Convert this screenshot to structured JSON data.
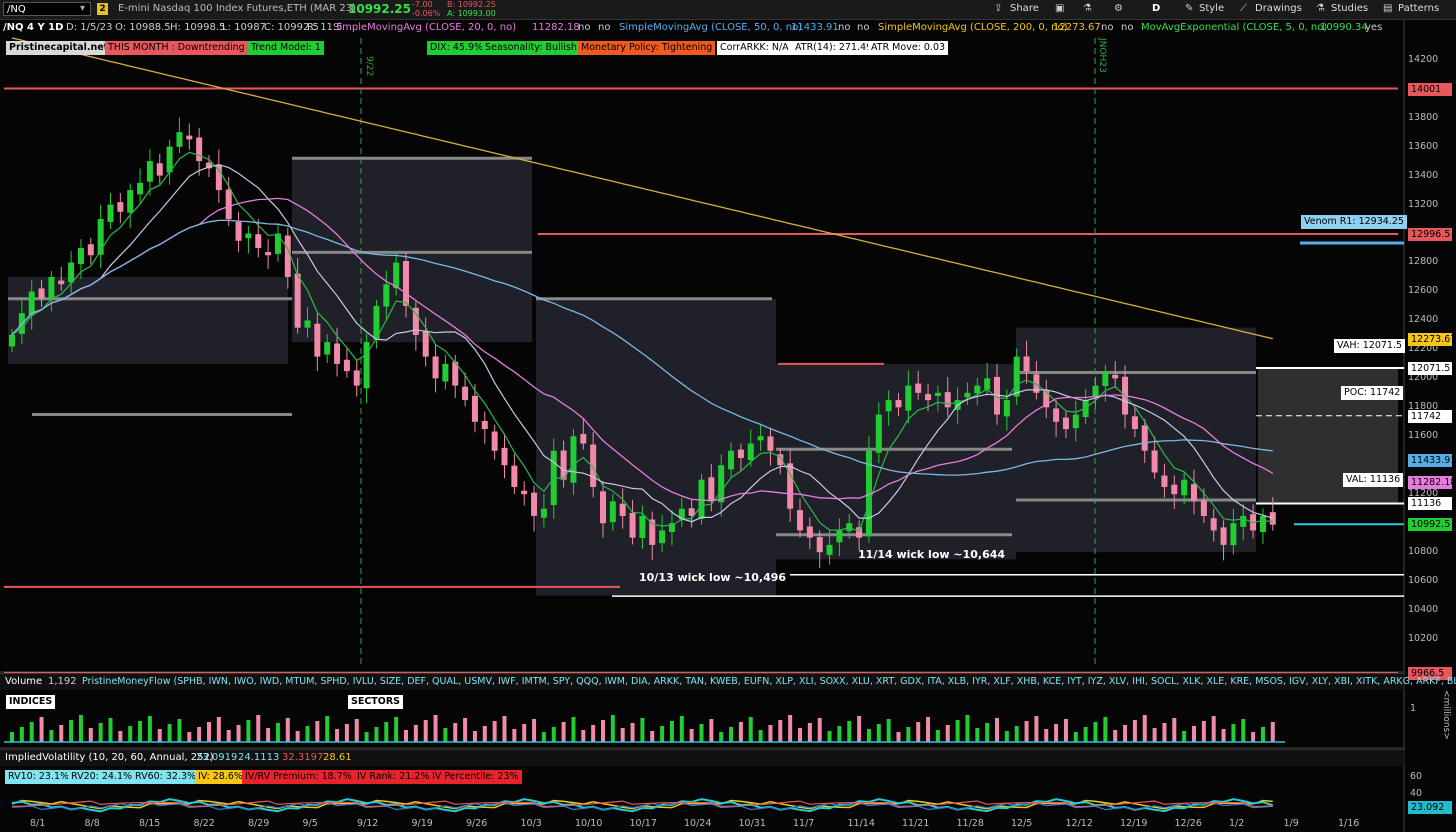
{
  "toolbar": {
    "symbol": "/NQ",
    "badge": "2",
    "description": "E-mini Nasdaq 100 Index Futures,ETH (MAR 23)",
    "last_price": "10992.25",
    "change": "-7.00",
    "change_pct": "-0.06%",
    "bid": "B: 10992.25",
    "ask": "A: 10993.00",
    "share": "Share",
    "timeframe": "D",
    "style": "Style",
    "drawings": "Drawings",
    "studies": "Studies",
    "patterns": "Patterns"
  },
  "studyline": {
    "chart_label": "/NQ 4 Y 1D",
    "date": "D: 1/5/23",
    "open": "O: 10988.5",
    "high": "H: 10998.5",
    "low": "L: 10987",
    "close": "C: 10992.5",
    "range": "R: 11.5",
    "sma20": "SimpleMovingAvg (CLOSE, 20, 0, no)",
    "sma20_val": "11282.18",
    "sma50": "SimpleMovingAvg (CLOSE, 50, 0, no)",
    "sma50_val": "11433.91",
    "sma200": "SimpleMovingAvg (CLOSE, 200, 0, no)",
    "sma200_val": "12273.67",
    "ema5": "MovAvgExponential (CLOSE, 5, 0, no)",
    "ema5_val": "10990.34",
    "no": "no",
    "yes": "yes"
  },
  "labels": {
    "site": "Pristinecapital.net",
    "month": "THIS MONTH : Downtrending",
    "trend": "Trend Model: 1",
    "dix": "DIX: 45.9%",
    "season": "Seasonality: Bullish",
    "monetary": "Monetary Policy: Tightening",
    "corr": "CorrARKK: N/A",
    "atr": "ATR(14): 271.49",
    "atrmove": "ATR Move: 0.03",
    "venom": "Venom R1: 12934.25",
    "vah": "VAH: 12071.5",
    "poc": "POC: 11742",
    "val": "VAL: 11136",
    "wick1": "11/14 wick low ~10,644",
    "wick2": "10/13 wick low ~10,496",
    "vline1": "9/22",
    "vline2": "JNOH23"
  },
  "price_tags": [
    {
      "text": "14001",
      "y": 14001,
      "bg": "#e8575c",
      "fg": "#000"
    },
    {
      "text": "12996.5",
      "y": 12996.5,
      "bg": "#e8575c",
      "fg": "#000"
    },
    {
      "text": "12273.67",
      "y": 12273.67,
      "bg": "#f5c518",
      "fg": "#000"
    },
    {
      "text": "12071.5",
      "y": 12071.5,
      "bg": "#ffffff",
      "fg": "#000"
    },
    {
      "text": "11742",
      "y": 11742,
      "bg": "#ffffff",
      "fg": "#000"
    },
    {
      "text": "11433.91",
      "y": 11433.91,
      "bg": "#55aee8",
      "fg": "#000"
    },
    {
      "text": "11282.18",
      "y": 11282.18,
      "bg": "#e87be0",
      "fg": "#000"
    },
    {
      "text": "11136",
      "y": 11136,
      "bg": "#ffffff",
      "fg": "#000"
    },
    {
      "text": "10992.5",
      "y": 10992.5,
      "bg": "#22cc33",
      "fg": "#000"
    },
    {
      "text": "9966.5",
      "y": 9966.5,
      "bg": "#e8575c",
      "fg": "#000"
    }
  ],
  "volume_panel": {
    "title": "Volume",
    "value": "1,192",
    "study": "PristineMoneyFlow (SPHB, IWN, IWO, IWD, MTUM, SPHD, IVLU, SIZE, DEF, QUAL, USMV, IWF, IMTM, SPY, QQQ, IWM, DIA, ARKK, TAN, KWEB, EUFN, XLP, XLI, SOXX, XLU, XRT, GDX, ITA, XLB, IYR, XLF, XHB, KCE, IYT, IYZ, XLV, IHI, SOCL, XLK, XLE, KRE, MSOS, IGV, XLY, XBI, XITK, ARKG, ARKF, BLOK)",
    "indices": "INDICES",
    "sectors": "SECTORS",
    "unit": "<millions>",
    "tick": "1"
  },
  "iv_panel": {
    "title": "ImpliedVolatility (10, 20, 60, Annual, 252)",
    "v1": "23.0919",
    "v2": "24.1113",
    "v3": "32.3197",
    "v4": "28.61",
    "rv10": "RV10: 23.1%",
    "rv20": "RV20: 24.1%",
    "rv60": "RV60: 32.3%",
    "iv": "IV: 28.6%",
    "ivrv": "IV/RV Premium: 18.7%",
    "ivrank": "IV Rank: 21.2%",
    "ivpct": "IV Percentile: 23%",
    "tag": "23.092",
    "ticks": [
      "60",
      "40",
      "20"
    ]
  },
  "chart_data": {
    "type": "candlestick",
    "ylim": [
      10000,
      14350
    ],
    "y_ticks": [
      14200,
      14000,
      13800,
      13600,
      13400,
      13200,
      13000,
      12800,
      12600,
      12400,
      12200,
      12000,
      11800,
      11600,
      11400,
      11200,
      11000,
      10800,
      10600,
      10400,
      10200
    ],
    "x_ticks": [
      "8/1",
      "8/8",
      "8/15",
      "8/22",
      "8/29",
      "9/5",
      "9/12",
      "9/19",
      "9/26",
      "10/3",
      "10/10",
      "10/17",
      "10/24",
      "10/31",
      "11/7",
      "11/14",
      "11/21",
      "11/28",
      "12/5",
      "12/12",
      "12/19",
      "12/26",
      "1/2",
      "1/9",
      "1/16"
    ],
    "horizontal_levels": [
      14001,
      12996.5,
      9966.5,
      10560
    ],
    "value_area": {
      "vah": 12071.5,
      "poc": 11742,
      "val": 11136
    },
    "venom_r1": 12934.25,
    "wick_lows": [
      10644,
      10496
    ],
    "closes": [
      12300,
      12450,
      12600,
      12550,
      12700,
      12650,
      12800,
      12900,
      12850,
      13100,
      13200,
      13150,
      13300,
      13350,
      13500,
      13400,
      13600,
      13700,
      13650,
      13500,
      13450,
      13300,
      13100,
      12950,
      13000,
      12900,
      12850,
      13000,
      12700,
      12350,
      12400,
      12150,
      12250,
      12100,
      12050,
      11950,
      12250,
      12500,
      12650,
      12800,
      12500,
      12300,
      12150,
      12000,
      12100,
      11950,
      11850,
      11700,
      11650,
      11500,
      11400,
      11250,
      11200,
      11050,
      11100,
      11500,
      11300,
      11600,
      11550,
      11250,
      11000,
      11150,
      11050,
      10900,
      11050,
      10850,
      10950,
      11000,
      11100,
      11050,
      11300,
      11150,
      11400,
      11500,
      11450,
      11550,
      11600,
      11500,
      11400,
      11100,
      10950,
      10900,
      10800,
      10850,
      10950,
      11000,
      10900,
      11500,
      11750,
      11850,
      11800,
      11950,
      11900,
      11850,
      11900,
      11800,
      11850,
      11900,
      11950,
      12000,
      11750,
      11850,
      12150,
      12050,
      11900,
      11800,
      11700,
      11650,
      11750,
      11850,
      11950,
      12050,
      12000,
      11750,
      11650,
      11500,
      11350,
      11250,
      11200,
      11300,
      11150,
      11050,
      10950,
      10850,
      11000,
      11050,
      10950,
      11050,
      10990
    ]
  }
}
